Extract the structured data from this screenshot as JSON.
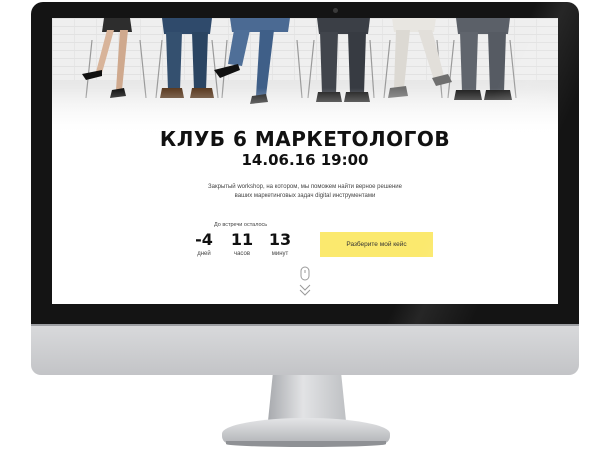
{
  "site": {
    "title": "КЛУБ 6 МАРКЕТОЛОГОВ",
    "event_datetime": "14.06.16 19:00",
    "description_lines": [
      "Закрытый workshop, на котором, мы поможем найти верное решение",
      "ваших маркетинговых задач digital инструментами"
    ],
    "countdown": {
      "label": "До встречи осталось",
      "days": {
        "value": "-4",
        "unit": "дней"
      },
      "hours": {
        "value": "11",
        "unit": "часов"
      },
      "minutes": {
        "value": "13",
        "unit": "минут"
      }
    },
    "cta_label": "Разберите мой кейс"
  },
  "icons": {
    "scroll": "mouse-scroll-icon",
    "chevrons": "double-chevron-down-icon"
  },
  "colors": {
    "accent": "#fbe96e",
    "text": "#111111",
    "bezel": "#141414",
    "aluminum": "#c9cacd"
  }
}
